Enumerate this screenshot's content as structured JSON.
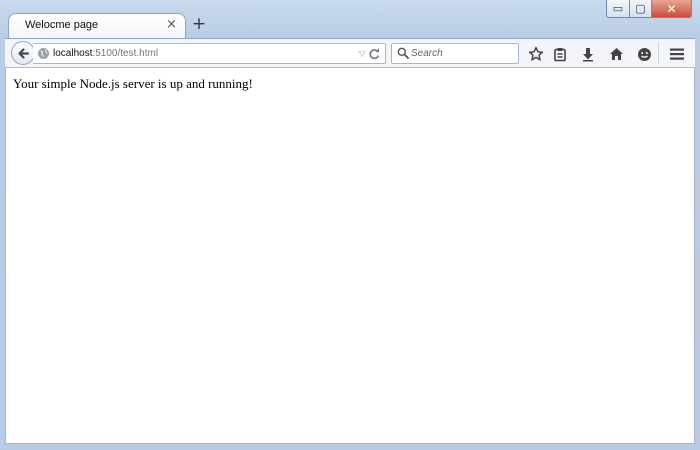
{
  "window": {
    "controls": {
      "minimize": "▭",
      "maximize": "▢",
      "close": "✕"
    }
  },
  "tabs": [
    {
      "title": "Welocme page",
      "close": "×"
    }
  ],
  "new_tab": "+",
  "toolbar": {
    "address": {
      "host": "localhost",
      "rest": ":5100/test.html"
    },
    "search_placeholder": "Search",
    "icons": [
      "back-icon",
      "globe-icon",
      "dropdown-icon",
      "reload-icon",
      "search-icon",
      "bookmark-star-icon",
      "reading-list-icon",
      "download-icon",
      "home-icon",
      "hello-icon",
      "menu-icon"
    ]
  },
  "page": {
    "text": "Your simple Node.js server is up and running!"
  }
}
